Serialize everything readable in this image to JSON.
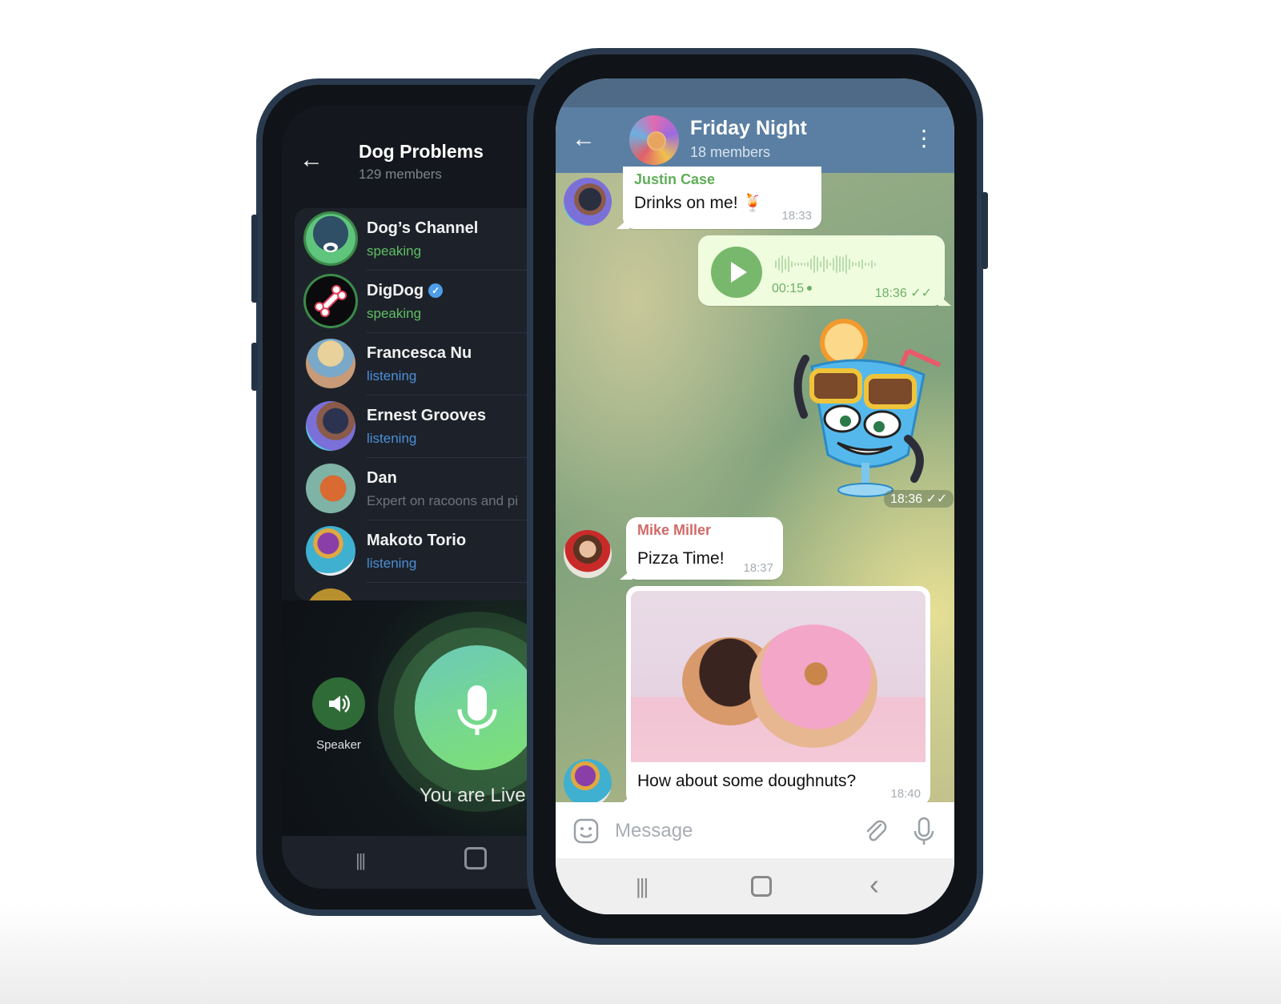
{
  "voice_chat": {
    "title": "Dog Problems",
    "subtitle": "129 members",
    "participants": [
      {
        "name": "Dog’s Channel",
        "status": "speaking",
        "status_type": "speaking"
      },
      {
        "name": "DigDog",
        "status": "speaking",
        "status_type": "speaking",
        "verified": true
      },
      {
        "name": "Francesca Nu",
        "status": "listening",
        "status_type": "listening"
      },
      {
        "name": "Ernest Grooves",
        "status": "listening",
        "status_type": "listening"
      },
      {
        "name": "Dan",
        "status": "Expert on racoons and pi",
        "status_type": "about"
      },
      {
        "name": "Makoto Torio",
        "status": "listening",
        "status_type": "listening"
      }
    ],
    "speaker_label": "Speaker",
    "live_label": "You are Live",
    "verified_glyph": "✓"
  },
  "chat": {
    "title": "Friday Night",
    "subtitle": "18 members",
    "messages": [
      {
        "sender": "Justin Case",
        "sender_color": "#5fae58",
        "text": "Drinks on me! 🍹",
        "time": "18:33"
      },
      {
        "type": "voice",
        "duration": "00:15",
        "time": "18:36",
        "status": "✓✓"
      },
      {
        "type": "sticker",
        "time": "18:36",
        "status": "✓✓"
      },
      {
        "sender": "Mike Miller",
        "sender_color": "#d06a66",
        "text": "Pizza Time!",
        "time": "18:37"
      },
      {
        "type": "photo",
        "caption": "How about some doughnuts?",
        "time": "18:40"
      }
    ],
    "input_placeholder": "Message"
  },
  "icons": {
    "back": "←",
    "menu": "⋮",
    "speaker": "🔊",
    "nav_recent": "|||",
    "nav_home": "▢",
    "nav_back": "‹",
    "sticker": "☺",
    "attach": "📎",
    "mic": "🎙"
  }
}
